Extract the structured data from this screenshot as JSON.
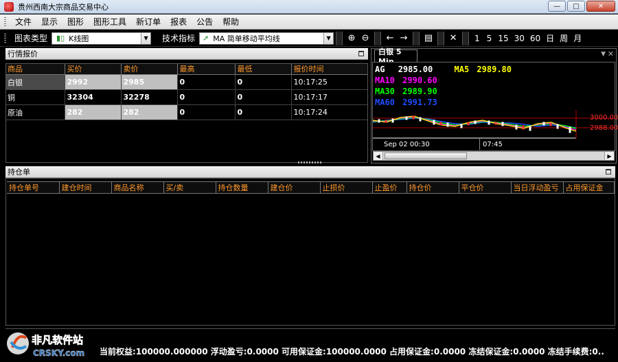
{
  "window": {
    "title": "贵州西南大宗商品交易中心"
  },
  "menu": [
    "文件",
    "显示",
    "图形",
    "图形工具",
    "新订单",
    "报表",
    "公告",
    "帮助"
  ],
  "toolbar": {
    "chart_type_label": "图表类型",
    "chart_type_value": "K线图",
    "indicator_label": "技术指标",
    "indicator_value": "MA 简单移动平均线",
    "periods": [
      "1",
      "5",
      "15",
      "30",
      "60",
      "日",
      "周",
      "月"
    ]
  },
  "quotes_panel": {
    "title": "行情报价",
    "headers": [
      "商品",
      "买价",
      "卖价",
      "最高",
      "最低",
      "报价时间"
    ],
    "rows": [
      {
        "name": "白银",
        "bid": "2992",
        "ask": "2985",
        "high": "0",
        "low": "0",
        "time": "10:17:25"
      },
      {
        "name": "铜",
        "bid": "32304",
        "ask": "32278",
        "high": "0",
        "low": "0",
        "time": "10:17:17"
      },
      {
        "name": "原油",
        "bid": "282",
        "ask": "282",
        "high": "0",
        "low": "0",
        "time": "10:17:24"
      }
    ]
  },
  "chart_panel": {
    "tab": "白银 5 Min",
    "symbol": "AG",
    "last": "2985.00",
    "ma5_label": "MA5",
    "ma5": "2989.80",
    "ma10_label": "MA10",
    "ma10": "2990.60",
    "ma30_label": "MA30",
    "ma30": "2989.90",
    "ma60_label": "MA60",
    "ma60": "2991.73",
    "price_levels": [
      "3000.00",
      "2988.00"
    ],
    "time_labels": [
      "Sep 02 00:30",
      "07:45"
    ],
    "colors": {
      "ma5": "#ffff00",
      "ma10": "#ff00ff",
      "ma30": "#00ff00",
      "ma60": "#1f4bff"
    }
  },
  "positions_panel": {
    "title": "持仓单",
    "headers": [
      "持仓单号",
      "建仓时间",
      "商品名称",
      "买/卖",
      "持仓数量",
      "建仓价",
      "止损价",
      "止盈价",
      "持仓价",
      "平仓价",
      "当日浮动盈亏",
      "占用保证金"
    ]
  },
  "status_bar": {
    "text": "当前权益:100000.000000  浮动盈亏:0.0000  可用保证金:100000.0000  占用保证金:0.0000  冻结保证金:0.0000  冻结手续费:0.."
  },
  "watermark": {
    "text": "非凡软件站",
    "subtext": "CRSKY.com"
  }
}
